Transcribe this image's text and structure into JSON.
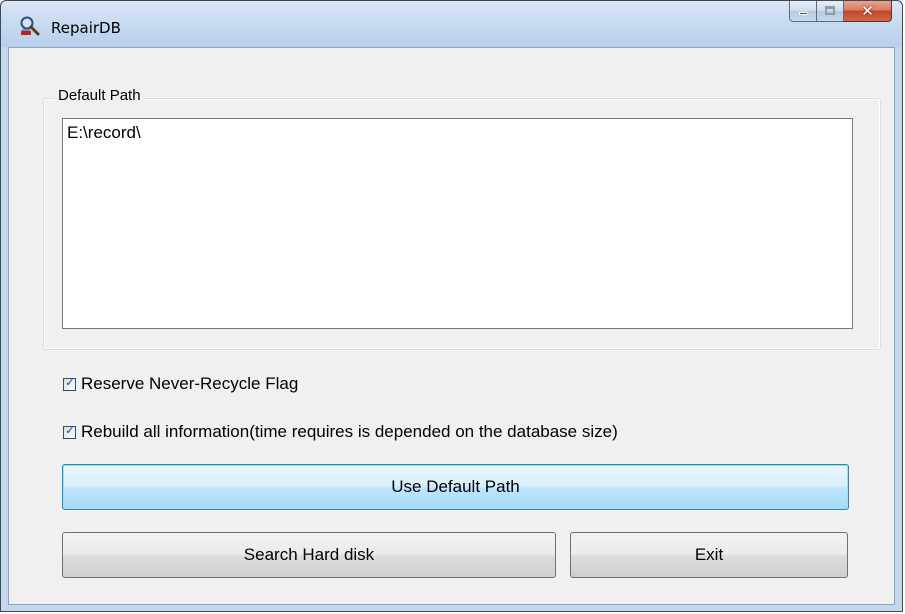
{
  "window": {
    "title": "RepairDB",
    "icon": "repair-db-app-icon",
    "controls": [
      "minimize-icon",
      "maximize-icon",
      "close-icon"
    ]
  },
  "default_path_group": {
    "label": "Default Path",
    "path_value": "E:\\record\\"
  },
  "options": {
    "reserve_flag": {
      "label": "Reserve Never-Recycle Flag",
      "checked": true
    },
    "rebuild_all": {
      "label": "Rebuild all information(time requires is depended on the database size)",
      "checked": true
    }
  },
  "buttons": {
    "use_default_path": "Use Default Path",
    "search_hard_disk": "Search Hard disk",
    "exit": "Exit"
  }
}
